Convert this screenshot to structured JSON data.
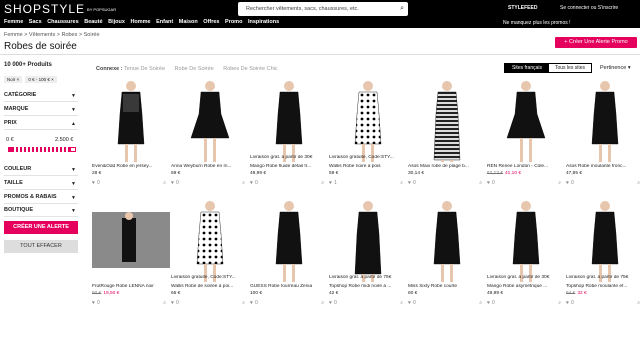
{
  "header": {
    "logo": "SHOPSTYLE",
    "logo_by": "BY POPSUGAR",
    "search_placeholder": "Rechercher vêtements, sacs, chaussures, etc.",
    "stylefeed": "STYLEFEED",
    "connect": "Se connecter ou S'inscrire"
  },
  "nav": {
    "items": [
      "Femme",
      "Sacs",
      "Chaussures",
      "Beauté",
      "Bijoux",
      "Homme",
      "Enfant",
      "Maison",
      "Offres",
      "Promo",
      "Inspirations"
    ],
    "promo_text": "Ne manquez plus les promos !"
  },
  "breadcrumb": "Femme > Vêtements > Robes > Soirée",
  "page_title": "Robes de soirée",
  "alert_button": "Créer Une Alerte Promo",
  "sidebar": {
    "count": "10 000+ Produits",
    "chips": [
      "Noir ×",
      "0 € - 100 € ×"
    ],
    "facets": [
      "CATÉGORIE",
      "MARQUE",
      "PRIX",
      "COULEUR",
      "TAILLE",
      "PROMOS & RABAIS",
      "BOUTIQUE"
    ],
    "price_low": "0 €",
    "price_high": "2.500 €",
    "create_alert": "CRÉER UNE ALERTE",
    "clear_all": "TOUT EFFACER"
  },
  "related": {
    "label": "Connexe :",
    "links": [
      "Tenue De Soirée",
      "Robe De Soirée",
      "Robes De Soirée Chic"
    ]
  },
  "sites": {
    "selected": "Sites français",
    "other": "Tous les sites"
  },
  "sort_label": "Pertinence",
  "products": [
    {
      "name": "Even&Odd Robe en jersey...",
      "price": "28 €",
      "old": "",
      "sale": "",
      "likes": "0"
    },
    {
      "name": "Anna Weyburn Robe en m...",
      "price": "59 €",
      "old": "",
      "sale": "",
      "likes": "0"
    },
    {
      "name": "Mango Robe fluide détail fr...",
      "price": "49,99 €",
      "old": "",
      "sale": "",
      "likes": "0",
      "promo": "Livraison grat. à partir de 30€"
    },
    {
      "name": "Wallis Robe noire à pois",
      "price": "59 €",
      "old": "",
      "sale": "",
      "likes": "1",
      "promo": "Livraison gratuite, Code:STY..."
    },
    {
      "name": "Asos Maxi robe de plage b...",
      "price": "30,14 €",
      "old": "",
      "sale": "",
      "likes": "0"
    },
    {
      "name": "REN Renee London - Cole...",
      "price": "",
      "old": "67,13 €",
      "sale": "41,10 €",
      "likes": "0"
    },
    {
      "name": "Asos Robe moulante fronc...",
      "price": "47,95 €",
      "old": "",
      "sale": "",
      "likes": "0"
    },
    {
      "name": "FrutRouge Robe LENNA noir",
      "price": "",
      "old": "60 €",
      "sale": "19,50 €",
      "likes": "0"
    },
    {
      "name": "Wallis Robe de soirée à poi...",
      "price": "65 €",
      "old": "",
      "sale": "",
      "likes": "0",
      "promo": "Livraison gratuite, Code:STY..."
    },
    {
      "name": "GUESS Robe fourreau Zenia",
      "price": "100 €",
      "old": "",
      "sale": "",
      "likes": "0"
    },
    {
      "name": "Topshop Robe midi noire à ...",
      "price": "42 €",
      "old": "",
      "sale": "",
      "likes": "0",
      "promo": "Livraison grat. à partir de 75€"
    },
    {
      "name": "Miss Sixty Robe courte",
      "price": "60 €",
      "old": "",
      "sale": "",
      "likes": "0"
    },
    {
      "name": "Mango Robe asymétrique ...",
      "price": "49,99 €",
      "old": "",
      "sale": "",
      "likes": "0",
      "promo": "Livraison grat. à partir de 30€"
    },
    {
      "name": "Topshop Robe moulante ef...",
      "price": "",
      "old": "64 €",
      "sale": "32 €",
      "likes": "0",
      "promo": "Livraison grat. à partir de 75€"
    }
  ]
}
